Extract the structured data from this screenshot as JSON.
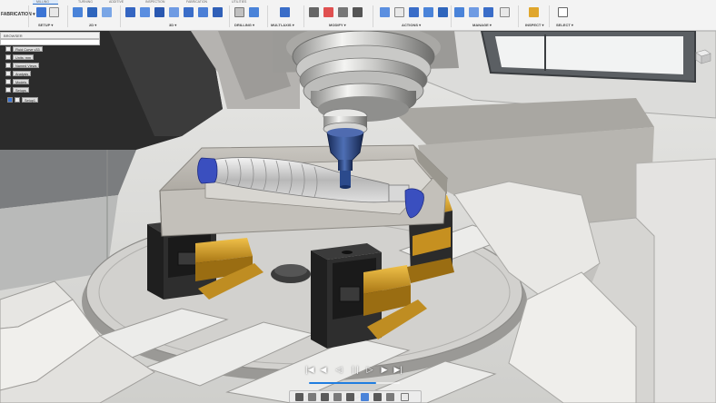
{
  "toolbar": {
    "workspace_label": "FABRICATION ▾",
    "tabs": [
      "MILLING",
      "TURNING",
      "ADDITIVE",
      "INSPECTION",
      "FABRICATION",
      "UTILITIES"
    ],
    "groups": [
      {
        "label": "SETUP ▾"
      },
      {
        "label": "2D ▾"
      },
      {
        "label": "3D ▾"
      },
      {
        "label": "DRILLING ▾"
      },
      {
        "label": "MULTI-AXIS ▾"
      },
      {
        "label": "MODIFY ▾"
      },
      {
        "label": "ACTIONS ▾"
      },
      {
        "label": "MANAGE ▾"
      },
      {
        "label": "INSPECT ▾"
      },
      {
        "label": "SELECT ▾"
      }
    ],
    "accent_color": "#2b6cc4"
  },
  "browser": {
    "header": "BROWSER",
    "search_placeholder": "",
    "items": [
      {
        "label": "Fluid Curve v33",
        "icon": "document-icon"
      },
      {
        "label": "Units: mm",
        "icon": "settings-icon"
      },
      {
        "label": "Named Views",
        "icon": "folder-icon"
      },
      {
        "label": "Analysis",
        "icon": "folder-icon"
      },
      {
        "label": "Models",
        "icon": "folder-icon"
      },
      {
        "label": "Setups",
        "icon": "folder-icon"
      },
      {
        "label": "Setup1",
        "icon": "setup-icon"
      }
    ]
  },
  "playback": {
    "controls": [
      "|◀",
      "◀",
      "◁",
      "| |",
      "▷",
      "▶",
      "▶|"
    ],
    "progress": 0.74
  },
  "colors": {
    "spindle_tool": "#25427e",
    "vise_steel": "#2a2a2a",
    "vise_brass": "#d8a12a",
    "stock": "#bab6af",
    "part_blue": "#3a4fbf"
  }
}
